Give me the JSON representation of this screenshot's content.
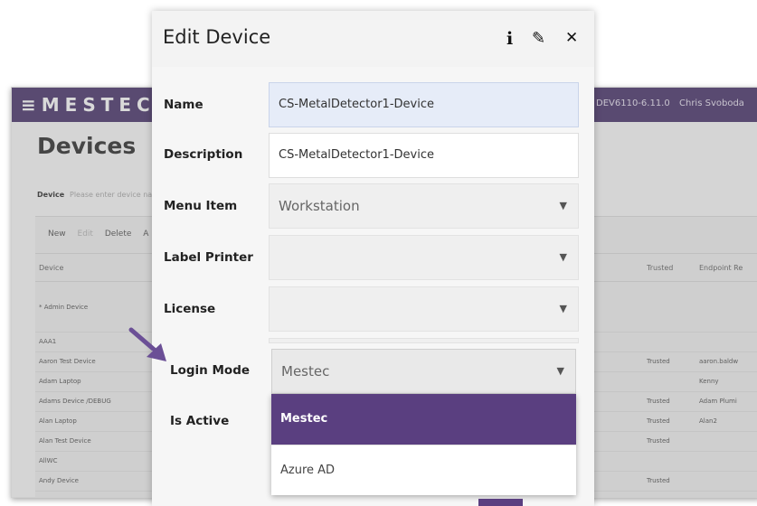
{
  "background": {
    "logo": "≡MESTEC",
    "version": "DEV6110-6.11.0",
    "user": "Chris Svoboda",
    "page_title": "Devices",
    "device_filter_label": "Device",
    "device_filter_placeholder": "Please enter device na",
    "toolbar": [
      "New",
      "Edit",
      "Delete",
      "A"
    ],
    "columns": {
      "device": "Device",
      "trusted": "Trusted",
      "endpoint": "Endpoint Re"
    },
    "rows": [
      {
        "device": "* Admin Device",
        "trusted": "",
        "endpoint": ""
      },
      {
        "device": "AAA1",
        "trusted": "",
        "endpoint": ""
      },
      {
        "device": "Aaron Test Device",
        "trusted": "Trusted",
        "endpoint": "aaron.baldw"
      },
      {
        "device": "Adam Laptop",
        "trusted": "",
        "endpoint": "Kenny"
      },
      {
        "device": "Adams Device /DEBUG",
        "trusted": "Trusted",
        "endpoint": "Adam Plumi"
      },
      {
        "device": "Alan Laptop",
        "trusted": "Trusted",
        "endpoint": "Alan2"
      },
      {
        "device": "Alan Test Device",
        "trusted": "Trusted",
        "endpoint": ""
      },
      {
        "device": "AllWC",
        "trusted": "",
        "endpoint": ""
      },
      {
        "device": "Andy Device",
        "trusted": "Trusted",
        "endpoint": ""
      }
    ]
  },
  "modal": {
    "title": "Edit Device",
    "icons": {
      "info": "info-icon",
      "edit": "pencil-icon",
      "close": "close-icon"
    },
    "fields": {
      "name": {
        "label": "Name",
        "value": "CS-MetalDetector1-Device"
      },
      "description": {
        "label": "Description",
        "value": "CS-MetalDetector1-Device"
      },
      "menu_item": {
        "label": "Menu Item",
        "value": "Workstation"
      },
      "label_printer": {
        "label": "Label Printer",
        "value": ""
      },
      "license": {
        "label": "License",
        "value": ""
      },
      "login_mode": {
        "label": "Login Mode",
        "value": "Mestec"
      },
      "is_active": {
        "label": "Is Active"
      }
    },
    "login_mode_options": [
      "Mestec",
      "Azure AD"
    ]
  },
  "colors": {
    "brand_purple": "#5a3f80",
    "arrow": "#6b4f96"
  }
}
